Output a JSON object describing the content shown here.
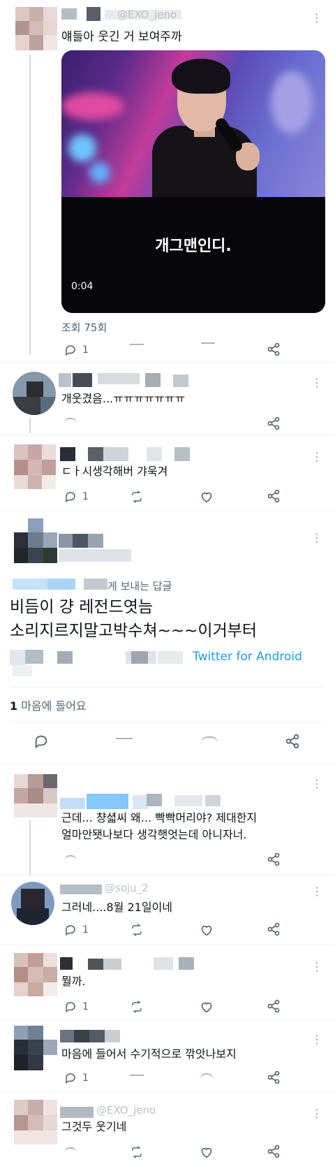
{
  "colors": {
    "accent": "#1d9bf0",
    "icon_gray": "#536471",
    "thread_line": "#cfd9de",
    "divider": "#eff3f4"
  },
  "tweet1": {
    "handle": "@EXO_jeno",
    "text": "얘들아 웃긴 거 보여주까",
    "video": {
      "subtitle": "개그맨인디.",
      "duration": "0:04"
    },
    "views": "조회 75회",
    "actions": {
      "reply_count": "1",
      "more_icon": "more-dots-icon"
    }
  },
  "reply1": {
    "text": "개웃겼음...ㅠㅠㅠㅠㅠㅠㅠ"
  },
  "reply2": {
    "text": "ㄷㅏ시생각해버 갸욱겨",
    "reply_count": "1"
  },
  "focused": {
    "reply_to": "게 보내는 답글",
    "text_line1": "비듬이 걍 레전드엿늠",
    "text_line2": "소리지르지말고박수쳐~~~이거부터",
    "source": "Twitter for Android",
    "likes_count": "1",
    "likes_label": "마음에 들어요"
  },
  "reply3": {
    "text_line1": "근데... 챵셟씨 왜... 빡빡머리야? 제대한지",
    "text_line2": "얼마안됏나보다 생각햇엇는데 아니자너."
  },
  "reply4": {
    "handle": "@soju_2",
    "text": "그러네....8월 21일이네",
    "reply_count": "1"
  },
  "reply5": {
    "text": "뭘까.",
    "reply_count": "1"
  },
  "reply6": {
    "text": "마음에 들어서 수기적으로 깎앗나보지",
    "reply_count": "1"
  },
  "reply7": {
    "handle": "@EXO_jeno",
    "text": "그것두 웃기네"
  }
}
